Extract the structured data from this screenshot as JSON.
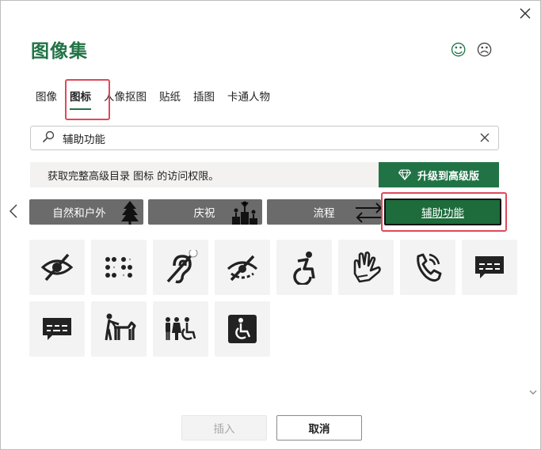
{
  "dialog": {
    "title": "图像集"
  },
  "feedback": {
    "happy_glyph": "☺",
    "sad_glyph": "☹"
  },
  "tabs": [
    {
      "label": "图像",
      "active": false
    },
    {
      "label": "图标",
      "active": true
    },
    {
      "label": "人像抠图",
      "active": false
    },
    {
      "label": "贴纸",
      "active": false
    },
    {
      "label": "插图",
      "active": false
    },
    {
      "label": "卡通人物",
      "active": false
    }
  ],
  "search": {
    "value": "辅助功能",
    "icon": "search-icon",
    "clear_icon": "close-icon"
  },
  "banner": {
    "text": "获取完整高级目录 图标 的访问权限。"
  },
  "upgrade": {
    "label": "升级到高级版",
    "icon": "diamond-icon"
  },
  "categories": [
    {
      "label": "自然和户外",
      "active": false
    },
    {
      "label": "庆祝",
      "active": false
    },
    {
      "label": "流程",
      "active": false
    },
    {
      "label": "辅助功能",
      "active": true
    }
  ],
  "icons": [
    "eye-crossed-icon",
    "braille-icon",
    "hearing-impaired-icon",
    "low-vision-icon",
    "wheelchair-active-icon",
    "sign-language-icon",
    "phone-volume-icon",
    "closed-caption-icon",
    "caption-bubble-icon",
    "guide-dog-icon",
    "accessible-restroom-icon",
    "accessible-symbol-icon"
  ],
  "buttons": {
    "insert": "插入",
    "cancel": "取消"
  },
  "colors": {
    "accent": "#217346",
    "category_bg": "#6b6b6b",
    "highlight": "#e0485a"
  }
}
